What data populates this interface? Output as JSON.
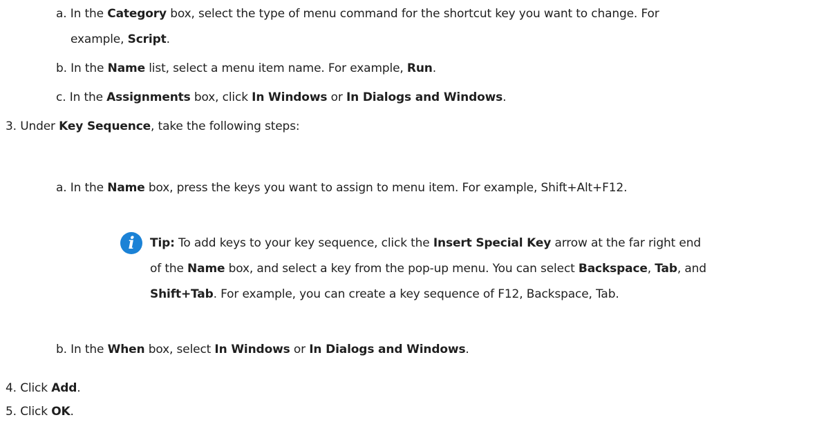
{
  "steps": {
    "step2_sub": {
      "a": {
        "marker": "a.",
        "t1": "In the ",
        "b1": "Category",
        "t2": " box, select the type of menu command for the shortcut key you want to change. For",
        "t3": "example, ",
        "b2": "Script",
        "t4": "."
      },
      "b": {
        "marker": "b.",
        "t1": "In the ",
        "b1": "Name",
        "t2": " list, select a menu item name. For example, ",
        "b2": "Run",
        "t3": "."
      },
      "c": {
        "marker": "c.",
        "t1": "In the ",
        "b1": "Assignments",
        "t2": " box, click ",
        "b2": "In Windows",
        "t3": " or ",
        "b3": "In Dialogs and Windows",
        "t4": "."
      }
    },
    "step3": {
      "marker": "3.",
      "t1": "Under ",
      "b1": "Key Sequence",
      "t2": ", take the following steps:",
      "a": {
        "marker": "a.",
        "t1": "In the ",
        "b1": "Name",
        "t2": " box, press the keys you want to assign to menu item. For example, Shift+Alt+F12."
      },
      "tip": {
        "icon": "info-i-icon",
        "icon_glyph": "i",
        "label": "Tip:",
        "t1": " To add keys to your key sequence, click the ",
        "b1": "Insert Special Key",
        "t2": " arrow at the far right end",
        "t3": "of the ",
        "b2": "Name",
        "t4": " box, and select a key from the pop-up menu. You can select ",
        "b3": "Backspace",
        "t5": ", ",
        "b4": "Tab",
        "t6": ", and",
        "b5": "Shift+Tab",
        "t7": ". For example, you can create a key sequence of F12, Backspace, Tab."
      },
      "b": {
        "marker": "b.",
        "t1": "In the ",
        "b1": "When",
        "t2": " box, select ",
        "b2": "In Windows",
        "t3": " or ",
        "b3": "In Dialogs and Windows",
        "t4": "."
      }
    },
    "step4": {
      "marker": "4.",
      "t1": "Click ",
      "b1": "Add",
      "t2": "."
    },
    "step5": {
      "marker": "5.",
      "t1": "Click ",
      "b1": "OK",
      "t2": "."
    }
  },
  "colors": {
    "text": "#1f1f1f",
    "tip_icon_bg": "#1b82d6"
  }
}
